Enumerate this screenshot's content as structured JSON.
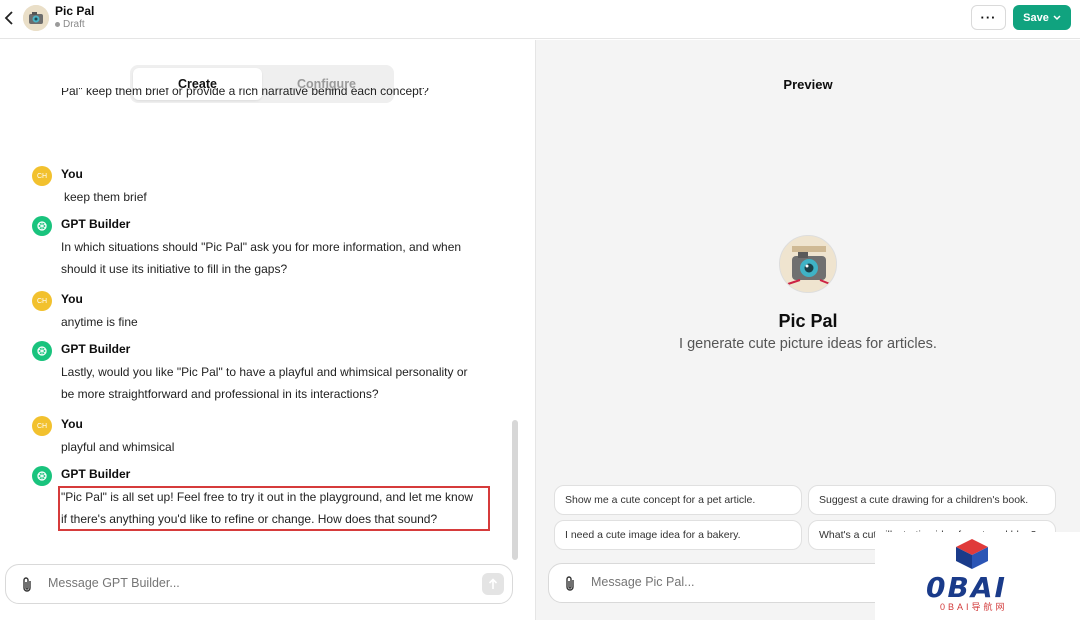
{
  "header": {
    "title": "Pic Pal",
    "status": "Draft",
    "more_label": "···",
    "save_label": "Save"
  },
  "tabs": [
    {
      "label": "Create",
      "active": true
    },
    {
      "label": "Configure",
      "active": false
    }
  ],
  "chat": {
    "cut_line": "Pal\" keep them brief or provide a rich narrative behind each concept?",
    "messages": [
      {
        "author": "You",
        "avatar": "CH",
        "lines": [
          "keep them brief"
        ]
      },
      {
        "author": "GPT Builder",
        "avatar": "openai-icon",
        "lines": [
          "In which situations should \"Pic Pal\" ask you for more information, and when",
          "should it use its initiative to fill in the gaps?"
        ]
      },
      {
        "author": "You",
        "avatar": "CH",
        "lines": [
          "anytime is fine"
        ]
      },
      {
        "author": "GPT Builder",
        "avatar": "openai-icon",
        "lines": [
          "Lastly, would you like \"Pic Pal\" to have a playful and whimsical personality or",
          "be more straightforward and professional in its interactions?"
        ]
      },
      {
        "author": "You",
        "avatar": "CH",
        "lines": [
          "playful and whimsical"
        ]
      },
      {
        "author": "GPT Builder",
        "avatar": "openai-icon",
        "lines": [
          "\"Pic Pal\" is all set up! Feel free to try it out in the playground, and let me know",
          "if there's anything you'd like to refine or change. How does that sound?"
        ]
      }
    ]
  },
  "composer": {
    "placeholder": "Message GPT Builder..."
  },
  "preview": {
    "title": "Preview",
    "name": "Pic Pal",
    "description": "I generate cute picture ideas for articles.",
    "suggestions": [
      "Show me a cute concept for a pet article.",
      "Suggest a cute drawing for a children's book.",
      "I need a cute image idea for a bakery.",
      "What's a cute illustration idea for a travel blog?"
    ],
    "composer_placeholder": "Message Pic Pal..."
  },
  "watermark": {
    "brand": "0BAI",
    "sub": "0BAI导航网"
  },
  "colors": {
    "accent": "#10a37f",
    "you_avatar": "#f2c12e",
    "gpt_avatar": "#19c37d",
    "highlight": "#d63b3b"
  }
}
